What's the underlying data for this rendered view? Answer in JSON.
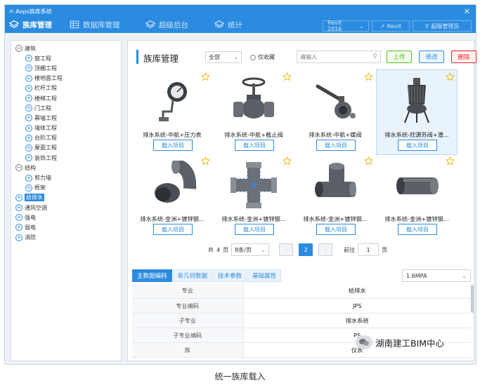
{
  "app": {
    "title": "Aops族库系统",
    "close_glyph": "✕",
    "nav_tabs": [
      {
        "label": "族库管理",
        "icon": "layers-icon"
      },
      {
        "label": "数据库管理",
        "icon": "database-icon"
      },
      {
        "label": "超级后台",
        "icon": "layers-icon"
      },
      {
        "label": "统计",
        "icon": "layers-icon"
      }
    ],
    "revit_version": "Revit 2016",
    "revit_button": "Revit",
    "user_button": "超级管理员"
  },
  "sidebar": {
    "tree": [
      {
        "label": "建筑",
        "level": 0,
        "expanded": true
      },
      {
        "label": "窗工程",
        "level": 1
      },
      {
        "label": "顶棚工程",
        "level": 1
      },
      {
        "label": "楼地面工程",
        "level": 1
      },
      {
        "label": "栏杆工程",
        "level": 1
      },
      {
        "label": "楼梯工程",
        "level": 1
      },
      {
        "label": "门工程",
        "level": 1
      },
      {
        "label": "幕墙工程",
        "level": 1
      },
      {
        "label": "墙体工程",
        "level": 1
      },
      {
        "label": "台阶工程",
        "level": 1
      },
      {
        "label": "屋面工程",
        "level": 1
      },
      {
        "label": "装饰工程",
        "level": 1
      },
      {
        "label": "结构",
        "level": 0,
        "expanded": true
      },
      {
        "label": "剪力墙",
        "level": 1
      },
      {
        "label": "框架",
        "level": 1
      },
      {
        "label": "给排水",
        "level": 0,
        "selected": true
      },
      {
        "label": "通风空调",
        "level": 0
      },
      {
        "label": "强电",
        "level": 0
      },
      {
        "label": "弱电",
        "level": 0
      },
      {
        "label": "消防",
        "level": 0
      }
    ]
  },
  "main": {
    "title": "族库管理",
    "filter": {
      "value": "全部"
    },
    "favorites_only_label": "仅收藏",
    "search": {
      "placeholder": "请输入"
    },
    "buttons": {
      "upload": "上传",
      "edit": "修改",
      "delete": "删除"
    },
    "cards": [
      {
        "name": "排水系统-中航+压力表",
        "load_label": "载入项目",
        "icon": "pressure-gauge-icon",
        "highlighted": false
      },
      {
        "name": "排水系统-中航+截止阀",
        "load_label": "载入项目",
        "icon": "globe-valve-icon",
        "highlighted": false
      },
      {
        "name": "排水系统-中航+蝶阀",
        "load_label": "载入项目",
        "icon": "butterfly-valve-icon",
        "highlighted": false
      },
      {
        "name": "排水系统-欣源苏阀+潜...",
        "load_label": "载入项目",
        "icon": "submersible-pump-icon",
        "highlighted": true
      },
      {
        "name": "排水系统-金洲+镀锌钢...",
        "load_label": "载入项目",
        "icon": "pipe-elbow-icon",
        "highlighted": false
      },
      {
        "name": "排水系统-金洲+镀锌钢...",
        "load_label": "载入项目",
        "icon": "pipe-cross-icon",
        "highlighted": false
      },
      {
        "name": "排水系统-金洲+镀锌钢...",
        "load_label": "载入项目",
        "icon": "pipe-tee-icon",
        "highlighted": false
      },
      {
        "name": "排水系统-金洲+镀锌钢...",
        "load_label": "载入项目",
        "icon": "pipe-straight-icon",
        "highlighted": false
      }
    ],
    "pagination": {
      "total_prefix": "共",
      "total_pages": "4",
      "total_suffix": "页",
      "page_size": "8条/页",
      "current_page": "2",
      "goto_label": "前往",
      "goto_value": "1",
      "goto_suffix": "页"
    },
    "detail_tabs": [
      "主数据编码",
      "非几何数据",
      "技术参数",
      "基础属性"
    ],
    "active_detail_tab": 0,
    "pressure_select": "1.6MPA",
    "properties": [
      {
        "key": "专业",
        "value": "给排水"
      },
      {
        "key": "专业编码",
        "value": "JPS"
      },
      {
        "key": "子专业",
        "value": "排水系统"
      },
      {
        "key": "子专业编码",
        "value": "PS"
      },
      {
        "key": "族",
        "value": "仪表"
      }
    ]
  },
  "watermark": "湖南建工BIM中心",
  "caption": "统一族库载入",
  "colors": {
    "accent": "#2b8be0",
    "star": "#f0b400",
    "upload": "#52c41a",
    "delete": "#f5222d"
  }
}
